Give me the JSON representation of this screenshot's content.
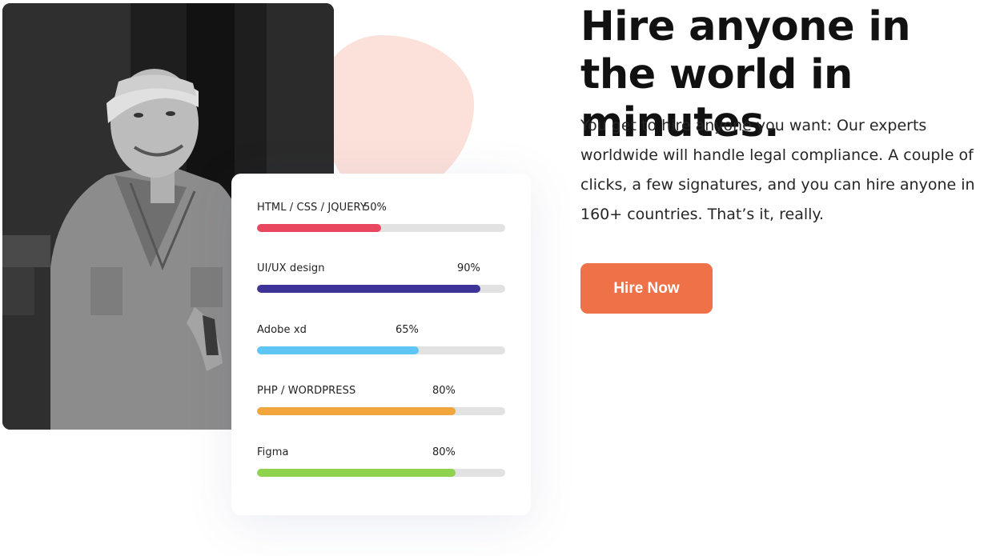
{
  "hero": {
    "headline": "Hire anyone in the world in minutes.",
    "description": "You get to hire anyone you want: Our experts worldwide will handle legal compliance. A couple of clicks, a few signatures, and you can hire anyone in 160+ countries. That’s it, really.",
    "cta_label": "Hire Now"
  },
  "skills": [
    {
      "label": "HTML / CSS / JQUERY",
      "percent_label": "50%",
      "value": 50,
      "color": "#e8475f"
    },
    {
      "label": "UI/UX design",
      "percent_label": "90%",
      "value": 90,
      "color": "#3e3399"
    },
    {
      "label": "Adobe xd",
      "percent_label": "65%",
      "value": 65,
      "color": "#5ec6f5"
    },
    {
      "label": "PHP / WORDPRESS",
      "percent_label": "80%",
      "value": 80,
      "color": "#f0a63c"
    },
    {
      "label": "Figma",
      "percent_label": "80%",
      "value": 80,
      "color": "#8fd24e"
    }
  ],
  "colors": {
    "accent": "#ee7148",
    "blob": "#fbe1d9",
    "track": "#e2e2e2"
  }
}
